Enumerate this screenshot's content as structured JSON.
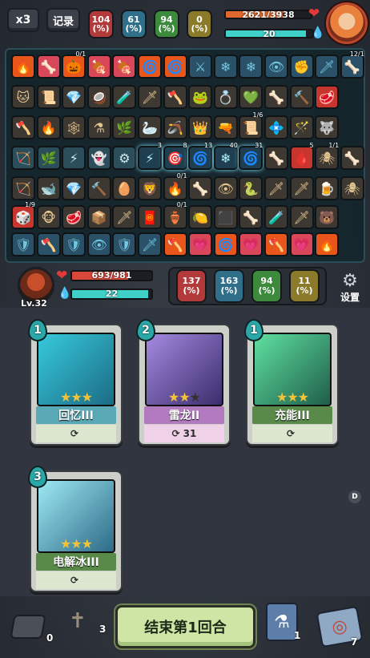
{
  "hud": {
    "speed_label": "x3",
    "log_label": "记录",
    "top_stats": [
      {
        "value": "104",
        "unit": "(%)",
        "color": "#b23a3a"
      },
      {
        "value": "61",
        "unit": "(%)",
        "color": "#2f6f8a"
      },
      {
        "value": "94",
        "unit": "(%)",
        "color": "#3d8a3d"
      },
      {
        "value": "0",
        "unit": "(%)",
        "color": "#8a7a2a"
      }
    ],
    "enemy_hp": "2621/3938",
    "enemy_hp_fraction": 0.666,
    "enemy_shield": "20",
    "enemy_shield_fraction": 0.93
  },
  "inventory": {
    "rows": [
      [
        {
          "i": "🔥",
          "c": "c-orange"
        },
        {
          "i": "🦴",
          "c": "c-pink"
        },
        {
          "i": "🎃",
          "c": "c-orange",
          "n": "0/1"
        },
        {
          "i": "🍖",
          "c": "c-pink"
        },
        {
          "i": "🍖",
          "c": "c-pink"
        },
        {
          "i": "🌀",
          "c": "c-orange"
        },
        {
          "i": "🌀",
          "c": "c-orange"
        },
        {
          "i": "⚔",
          "c": "c-blue"
        },
        {
          "i": "❄",
          "c": "c-blue"
        },
        {
          "i": "❄",
          "c": "c-blue"
        },
        {
          "i": "👁",
          "c": "c-blue"
        },
        {
          "i": "✊",
          "c": "c-blue"
        },
        {
          "i": "🗡",
          "c": "c-blue"
        },
        {
          "i": "🦴",
          "c": "c-blue",
          "n": "12/1"
        }
      ],
      [
        {
          "i": "🐱",
          "c": "c-dark"
        },
        {
          "i": "📜",
          "c": "c-dark"
        },
        {
          "i": "💎",
          "c": "c-dark"
        },
        {
          "i": "🥥",
          "c": "c-dark"
        },
        {
          "i": "🧪",
          "c": "c-dark"
        },
        {
          "i": "🗡",
          "c": "c-dark"
        },
        {
          "i": "🪓",
          "c": "c-dark"
        },
        {
          "i": "🐸",
          "c": "c-dark"
        },
        {
          "i": "💍",
          "c": "c-dark"
        },
        {
          "i": "💚",
          "c": "c-dark"
        },
        {
          "i": "🦴",
          "c": "c-dark"
        },
        {
          "i": "🔨",
          "c": "c-dark"
        },
        {
          "i": "🥩",
          "c": "c-red"
        }
      ],
      [
        {
          "i": "🪓",
          "c": "c-dark"
        },
        {
          "i": "🔥",
          "c": "c-dark"
        },
        {
          "i": "🕸",
          "c": "c-dark"
        },
        {
          "i": "⚗",
          "c": "c-dark"
        },
        {
          "i": "🌿",
          "c": "c-dark"
        },
        {
          "i": "🦢",
          "c": "c-dark"
        },
        {
          "i": "🪃",
          "c": "c-dark"
        },
        {
          "i": "👑",
          "c": "c-dark"
        },
        {
          "i": "🔫",
          "c": "c-dark"
        },
        {
          "i": "📜",
          "c": "c-dark",
          "n": "1/6"
        },
        {
          "i": "💠",
          "c": "c-dark"
        },
        {
          "i": "🪄",
          "c": "c-dark"
        },
        {
          "i": "🐺",
          "c": "c-dark"
        }
      ],
      [
        {
          "i": "🏹",
          "c": "c-tel"
        },
        {
          "i": "🌿",
          "c": "c-tel"
        },
        {
          "i": "⚡",
          "c": "c-tel"
        },
        {
          "i": "👻",
          "c": "c-tel"
        },
        {
          "i": "⚙",
          "c": "c-tel"
        },
        {
          "i": "⚡",
          "c": "c-glow",
          "n": "3"
        },
        {
          "i": "🎯",
          "c": "c-glow",
          "n": "8"
        },
        {
          "i": "🌀",
          "c": "c-glow",
          "n": "13"
        },
        {
          "i": "❄",
          "c": "c-glow",
          "n": "40"
        },
        {
          "i": "🌀",
          "c": "c-glow",
          "n": "31"
        },
        {
          "i": "🦴",
          "c": "c-dark"
        },
        {
          "i": "🩸",
          "c": "c-red",
          "n": "5"
        },
        {
          "i": "🕷",
          "c": "c-dark",
          "n": "1/1"
        },
        {
          "i": "🦴",
          "c": "c-dark"
        }
      ],
      [
        {
          "i": "🏹",
          "c": "c-dark"
        },
        {
          "i": "🐋",
          "c": "c-dark"
        },
        {
          "i": "💎",
          "c": "c-dark"
        },
        {
          "i": "🔨",
          "c": "c-dark"
        },
        {
          "i": "🥚",
          "c": "c-dark"
        },
        {
          "i": "🦁",
          "c": "c-dark"
        },
        {
          "i": "🔥",
          "c": "c-dark",
          "n": "0/1"
        },
        {
          "i": "🦴",
          "c": "c-dark"
        },
        {
          "i": "👁",
          "c": "c-dark"
        },
        {
          "i": "🐍",
          "c": "c-dark"
        },
        {
          "i": "🗡",
          "c": "c-dark"
        },
        {
          "i": "🗡",
          "c": "c-dark"
        },
        {
          "i": "🍺",
          "c": "c-dark"
        },
        {
          "i": "🕷",
          "c": "c-dark"
        }
      ],
      [
        {
          "i": "🎲",
          "c": "c-red",
          "n": "1/9"
        },
        {
          "i": "🐵",
          "c": "c-dark"
        },
        {
          "i": "🥩",
          "c": "c-dark"
        },
        {
          "i": "📦",
          "c": "c-dark"
        },
        {
          "i": "🗡",
          "c": "c-dark"
        },
        {
          "i": "🧧",
          "c": "c-dark"
        },
        {
          "i": "🏺",
          "c": "c-dark",
          "n": "0/1"
        },
        {
          "i": "🍋",
          "c": "c-dark"
        },
        {
          "i": "⬛",
          "c": "c-dark"
        },
        {
          "i": "🦴",
          "c": "c-dark"
        },
        {
          "i": "🧪",
          "c": "c-dark"
        },
        {
          "i": "🗡",
          "c": "c-dark"
        },
        {
          "i": "🐻",
          "c": "c-dark"
        }
      ],
      [
        {
          "i": "🛡",
          "c": "c-blue"
        },
        {
          "i": "🪓",
          "c": "c-blue"
        },
        {
          "i": "🛡",
          "c": "c-blue"
        },
        {
          "i": "👁",
          "c": "c-blue"
        },
        {
          "i": "🛡",
          "c": "c-blue"
        },
        {
          "i": "🗡",
          "c": "c-blue"
        },
        {
          "i": "🪓",
          "c": "c-orange"
        },
        {
          "i": "💗",
          "c": "c-pink"
        },
        {
          "i": "🌀",
          "c": "c-orange"
        },
        {
          "i": "💗",
          "c": "c-pink"
        },
        {
          "i": "🪓",
          "c": "c-orange"
        },
        {
          "i": "💗",
          "c": "c-pink"
        },
        {
          "i": "🔥",
          "c": "c-orange"
        }
      ]
    ]
  },
  "player": {
    "level": "Lv.32",
    "hp": "693/981",
    "hp_fraction": 0.706,
    "shield": "22",
    "shield_fraction": 0.96,
    "stats": [
      {
        "value": "137",
        "unit": "(%)",
        "color": "#b23a3a"
      },
      {
        "value": "163",
        "unit": "(%)",
        "color": "#2f6f8a"
      },
      {
        "value": "94",
        "unit": "(%)",
        "color": "#3d8a3d"
      },
      {
        "value": "11",
        "unit": "(%)",
        "color": "#8a7a2a"
      }
    ],
    "settings_label": "设置"
  },
  "hand": [
    {
      "cost": "1",
      "name": "回忆III",
      "name_color": "#5aa9b7",
      "stars": 3,
      "foot": "",
      "art": "linear-gradient(135deg,#37c9db,#1b6c86)"
    },
    {
      "cost": "2",
      "name": "雷龙II",
      "name_color": "#b27bbf",
      "stars": 2,
      "foot": "31",
      "art": "linear-gradient(135deg,#a48ae0,#3b2d6c)"
    },
    {
      "cost": "1",
      "name": "充能III",
      "name_color": "#5a8a4a",
      "stars": 3,
      "foot": "",
      "art": "linear-gradient(135deg,#5fe0a0,#1f5e4a)"
    },
    {
      "cost": "3",
      "name": "电解冰III",
      "name_color": "#5a8a4a",
      "stars": 3,
      "foot": "",
      "art": "linear-gradient(135deg,#9ee9f4,#2d6a87)"
    }
  ],
  "bottom": {
    "discard_count": "0",
    "grave_count": "3",
    "end_turn_label": "结束第1回合",
    "potion_count": "1",
    "deck_count": "7",
    "side_letter": "D"
  }
}
